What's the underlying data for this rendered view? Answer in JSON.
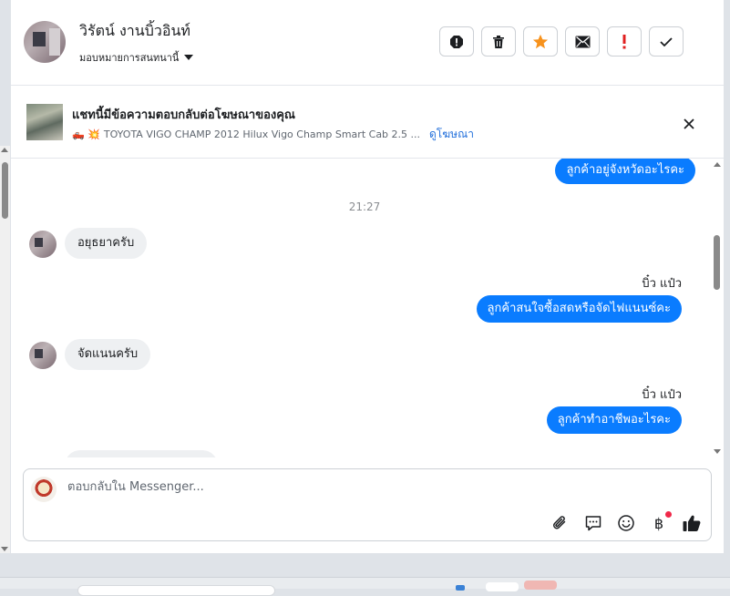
{
  "header": {
    "contact_name": "วิรัตน์ งานบิ้วอินท์",
    "assign_label": "มอบหมายการสนทนานี้",
    "actions": [
      {
        "name": "report",
        "icon": "alert-octagon-icon"
      },
      {
        "name": "delete",
        "icon": "trash-icon"
      },
      {
        "name": "star",
        "icon": "star-icon",
        "color": "#f7921c"
      },
      {
        "name": "mark-unread",
        "icon": "envelope-icon"
      },
      {
        "name": "follow-up",
        "icon": "exclamation-icon",
        "color": "#e02020"
      },
      {
        "name": "mark-done",
        "icon": "check-icon"
      }
    ]
  },
  "ad_banner": {
    "title": "แชทนี้มีข้อความตอบกลับต่อโฆษณาของคุณ",
    "emojis": "🛻 💥",
    "description": "TOYOTA VIGO CHAMP 2012 Hilux Vigo Champ Smart Cab 2.5 ...",
    "link": "ดูโฆษณา"
  },
  "messages": {
    "items": [
      {
        "type": "out",
        "text": "ลูกค้าอยู่จังหวัดอะไรคะ"
      },
      {
        "type": "time",
        "text": "21:27"
      },
      {
        "type": "in",
        "text": "อยุธยาครับ"
      },
      {
        "type": "out",
        "sender": "บิ๋ว แป๋ว",
        "text": "ลูกค้าสนใจซื้อสดหรือจัดไฟแนนซ์คะ"
      },
      {
        "type": "in",
        "text": "จัดแนนครับ"
      },
      {
        "type": "out",
        "sender": "บิ๋ว แป๋ว",
        "text": "ลูกค้าทำอาชีพอะไรคะ"
      }
    ]
  },
  "composer": {
    "placeholder": "ตอบกลับใน Messenger...",
    "icons": [
      "paperclip-icon",
      "saved-reply-icon",
      "emoji-icon",
      "baht-icon",
      "thumbs-up-icon"
    ],
    "baht_symbol": "฿"
  },
  "colors": {
    "bubble_out": "#0a7cff",
    "bubble_in": "#eef0f2",
    "link": "#216fdb"
  }
}
